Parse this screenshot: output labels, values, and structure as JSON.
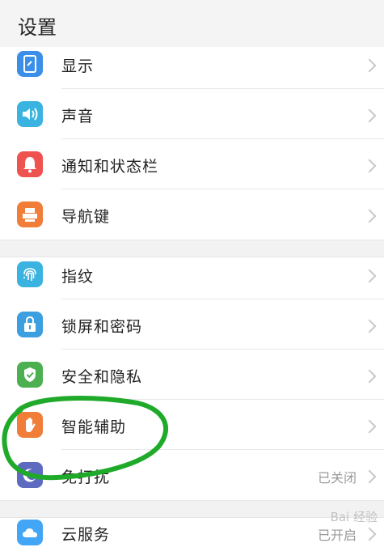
{
  "header": {
    "title": "设置"
  },
  "groups": [
    {
      "items": [
        {
          "label": "显示",
          "icon": "display-icon",
          "color": "#3b8fe8"
        },
        {
          "label": "声音",
          "icon": "speaker-icon",
          "color": "#3bb3e0"
        },
        {
          "label": "通知和状态栏",
          "icon": "bell-icon",
          "color": "#ef5350"
        },
        {
          "label": "导航键",
          "icon": "navigation-keys-icon",
          "color": "#f07d38"
        }
      ]
    },
    {
      "items": [
        {
          "label": "指纹",
          "icon": "fingerprint-icon",
          "color": "#3bb3e0"
        },
        {
          "label": "锁屏和密码",
          "icon": "lock-icon",
          "color": "#3b9fe0"
        },
        {
          "label": "安全和隐私",
          "icon": "shield-check-icon",
          "color": "#4caf50"
        },
        {
          "label": "智能辅助",
          "icon": "hand-icon",
          "color": "#f07d38"
        },
        {
          "label": "免打扰",
          "icon": "moon-icon",
          "color": "#5c6bc0",
          "status": "已关闭"
        }
      ]
    },
    {
      "items": [
        {
          "label": "云服务",
          "icon": "cloud-icon",
          "color": "#42a5f5",
          "status": "已开启"
        }
      ]
    }
  ],
  "annotation": {
    "color": "#1faa2a"
  },
  "watermark": "Bai 经验"
}
